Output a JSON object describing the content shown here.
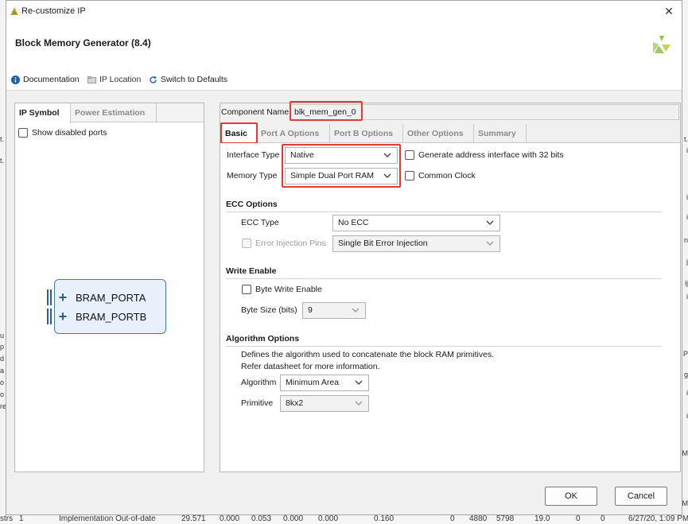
{
  "window": {
    "title": "Re-customize IP",
    "close_glyph": "✕"
  },
  "header": {
    "heading": "Block Memory Generator (8.4)",
    "logo": "xilinx-logo"
  },
  "toolbar": {
    "documentation": "Documentation",
    "ip_location": "IP Location",
    "switch_defaults": "Switch to Defaults"
  },
  "left_panel": {
    "tabs": [
      "IP Symbol",
      "Power Estimation"
    ],
    "active_tab": "IP Symbol",
    "show_disabled_ports": "Show disabled ports",
    "ports": [
      "BRAM_PORTA",
      "BRAM_PORTB"
    ]
  },
  "right_panel": {
    "component_name_label": "Component Name",
    "component_name_value": "blk_mem_gen_0",
    "tabs": [
      "Basic",
      "Port A Options",
      "Port B Options",
      "Other Options",
      "Summary"
    ],
    "active_tab": "Basic",
    "interface_type_label": "Interface Type",
    "interface_type_value": "Native",
    "memory_type_label": "Memory Type",
    "memory_type_value": "Simple Dual Port RAM",
    "gen_addr_label": "Generate address interface with 32 bits",
    "common_clock_label": "Common Clock",
    "ecc": {
      "section": "ECC Options",
      "type_label": "ECC Type",
      "type_value": "No ECC",
      "injection_label": "Error Injection Pins",
      "injection_value": "Single Bit Error Injection"
    },
    "write_enable": {
      "section": "Write Enable",
      "byte_write_label": "Byte Write Enable",
      "byte_size_label": "Byte Size (bits)",
      "byte_size_value": "9"
    },
    "algorithm": {
      "section": "Algorithm Options",
      "desc_line1": "Defines the algorithm used to concatenate the block RAM primitives.",
      "desc_line2": "Refer datasheet for more information.",
      "algorithm_label": "Algorithm",
      "algorithm_value": "Minimum Area",
      "primitive_label": "Primitive",
      "primitive_value": "8kx2"
    }
  },
  "buttons": {
    "ok": "OK",
    "cancel": "Cancel"
  },
  "background": {
    "left_chars": [
      "t.",
      "t.",
      "u",
      "p",
      "d",
      "a",
      "o",
      "o",
      "re",
      "i",
      "p"
    ],
    "right_chars": [
      "t.",
      "i",
      "i",
      "i",
      "n",
      "j",
      "ij",
      "i",
      "P",
      "g",
      "i",
      "i",
      "M",
      "M"
    ],
    "bottom_row": [
      "strs",
      "1",
      "Implementation Out-of-date",
      "29.571",
      "0.000",
      "0.053",
      "0.000",
      "0.000",
      "0.160",
      "0",
      "4880",
      "5798",
      "19.0",
      "0",
      "0",
      "6/27/20, 1:09 PM"
    ]
  },
  "colors": {
    "highlight": "#e53935",
    "symbol_border": "#4a77a6",
    "symbol_fill": "#e8f1fb"
  }
}
